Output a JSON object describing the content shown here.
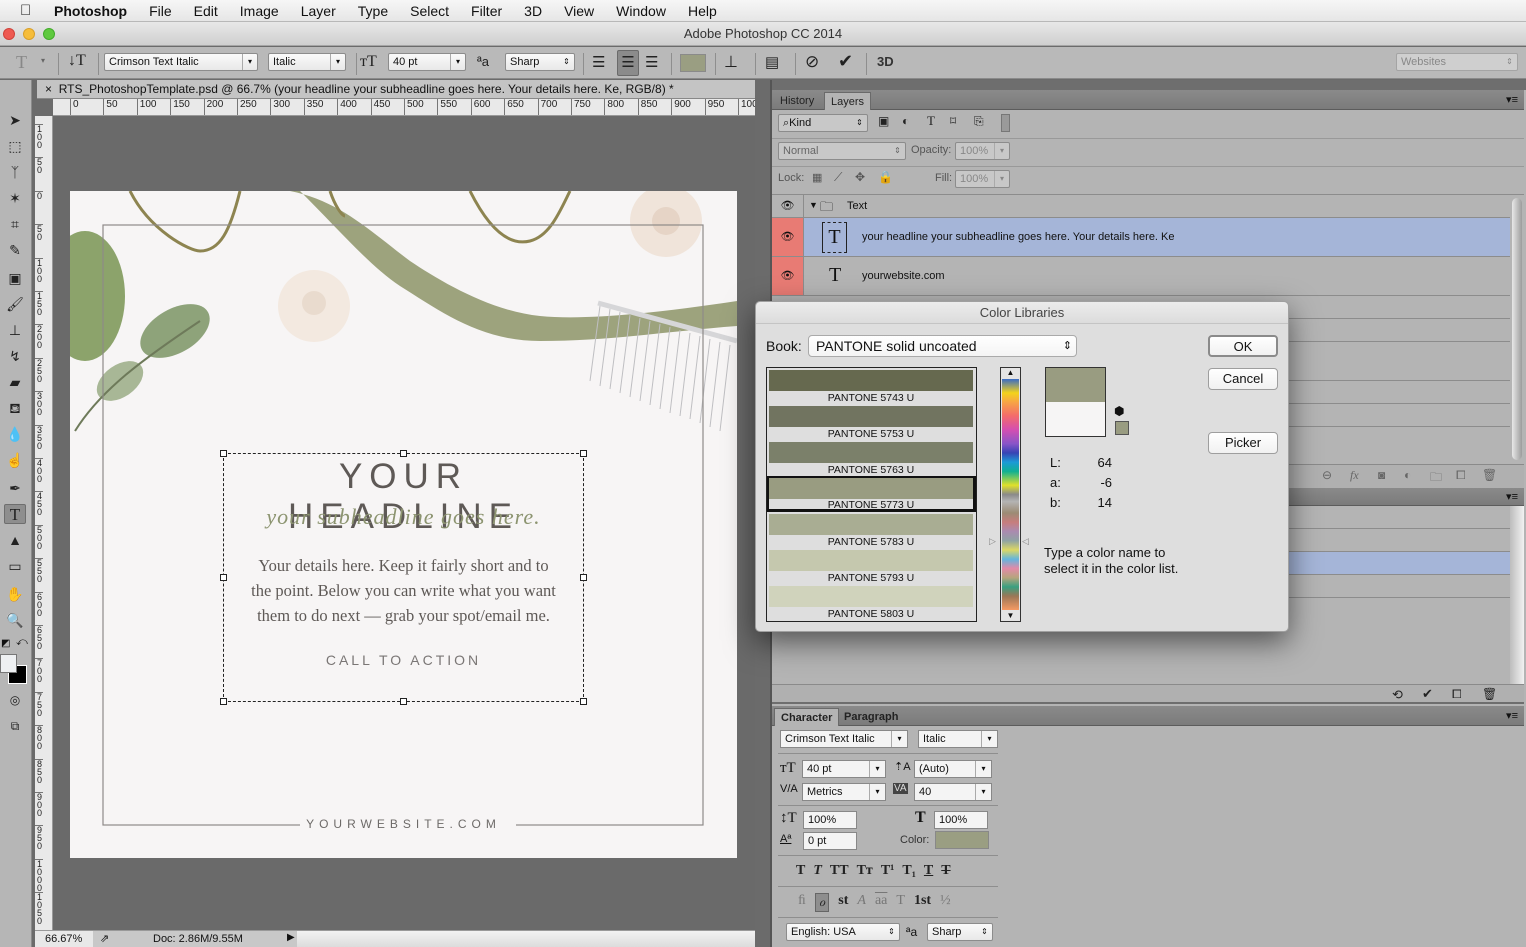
{
  "menubar": {
    "app": "Photoshop",
    "items": [
      "File",
      "Edit",
      "Image",
      "Layer",
      "Type",
      "Select",
      "Filter",
      "3D",
      "View",
      "Window",
      "Help"
    ]
  },
  "window": {
    "title": "Adobe Photoshop CC 2014"
  },
  "options_bar": {
    "tool_icon": "type-tool-icon",
    "font_family": "Crimson Text Italic",
    "font_style": "Italic",
    "font_size": "40 pt",
    "antialias": "Sharp",
    "align": [
      "left",
      "center",
      "right"
    ],
    "align_selected": "center",
    "text_color": "#9a9e82",
    "workspace": "Websites",
    "cancel_icon": "cancel-icon",
    "commit_icon": "commit-checkmark-icon",
    "threed_label": "3D"
  },
  "document": {
    "tab_title": "RTS_PhotoshopTemplate.psd @ 66.7% (your headline your subheadline goes here. Your details here. Ke, RGB/8) *",
    "close_glyph": "×",
    "h_ruler_ticks": [
      "0",
      "50",
      "100",
      "150",
      "200",
      "250",
      "300",
      "350",
      "400",
      "450",
      "500",
      "550",
      "600",
      "650",
      "700",
      "750",
      "800",
      "850",
      "900",
      "950",
      "100"
    ],
    "v_ruler_ticks": [
      "100",
      "50",
      "0",
      "50",
      "100",
      "150",
      "200",
      "250",
      "300",
      "350",
      "400",
      "450",
      "500",
      "550",
      "600",
      "650",
      "700",
      "750",
      "800",
      "850",
      "900",
      "950",
      "1000",
      "1050"
    ],
    "canvas": {
      "headline": "YOUR HEADLINE",
      "subheadline": "your subheadline goes here.",
      "details_lines": [
        "Your details here. Keep it fairly short and to",
        "the point. Below you can write what you want",
        "them to do next — grab your spot/email me."
      ],
      "cta": "CALL TO ACTION",
      "website": "YOURWEBSITE.COM"
    }
  },
  "status_bar": {
    "zoom": "66.67%",
    "doc": "Doc: 2.86M/9.55M"
  },
  "layers_panel": {
    "tabs": [
      "History",
      "Layers"
    ],
    "active_tab": "Layers",
    "filter_kind": "Kind",
    "blend_mode": "Normal",
    "opacity_label": "Opacity:",
    "opacity": "100%",
    "lock_label": "Lock:",
    "fill_label": "Fill:",
    "fill": "100%",
    "layers": [
      {
        "name": "Text",
        "type": "group",
        "expanded": true,
        "selected": false
      },
      {
        "name": "your headline your subheadline goes here. Your details here. Ke",
        "type": "text",
        "selected": true
      },
      {
        "name": "yourwebsite.com",
        "type": "text",
        "selected": false
      }
    ]
  },
  "color_libraries": {
    "title": "Color Libraries",
    "book_label": "Book:",
    "book": "PANTONE solid uncoated",
    "swatches": [
      {
        "name": "PANTONE 5743 U",
        "color": "#66694f"
      },
      {
        "name": "PANTONE 5753 U",
        "color": "#717460"
      },
      {
        "name": "PANTONE 5763 U",
        "color": "#7b806a"
      },
      {
        "name": "PANTONE 5773 U",
        "color": "#999c81",
        "selected": true
      },
      {
        "name": "PANTONE 5783 U",
        "color": "#a9ad93"
      },
      {
        "name": "PANTONE 5793 U",
        "color": "#c5c8ae"
      },
      {
        "name": "PANTONE 5803 U",
        "color": "#d0d3bc"
      }
    ],
    "new_color": "#999c81",
    "old_color": "#f6f5f5",
    "lab": {
      "L_label": "L:",
      "L": "64",
      "a_label": "a:",
      "a": "-6",
      "b_label": "b:",
      "b": "14"
    },
    "hint": [
      "Type a color name to",
      "select it in the color list."
    ],
    "buttons": {
      "ok": "OK",
      "cancel": "Cancel",
      "picker": "Picker"
    }
  },
  "character_panel": {
    "tabs": [
      "Character",
      "Paragraph"
    ],
    "active_tab": "Character",
    "font_family": "Crimson Text Italic",
    "font_style": "Italic",
    "size": "40 pt",
    "leading": "(Auto)",
    "kerning": "Metrics",
    "tracking": "40",
    "vertical_scale": "100%",
    "horizontal_scale": "100%",
    "baseline_shift": "0 pt",
    "color_label": "Color:",
    "color": "#9a9e82",
    "style_buttons": [
      "T",
      "T",
      "TT",
      "Tт",
      "T¹",
      "T₁",
      "T",
      "T"
    ],
    "opentype_buttons": [
      "ﬁ",
      "ℴ",
      "st",
      "A",
      "aa",
      "T",
      "1st",
      "½"
    ],
    "language": "English: USA",
    "antialias": "Sharp"
  }
}
